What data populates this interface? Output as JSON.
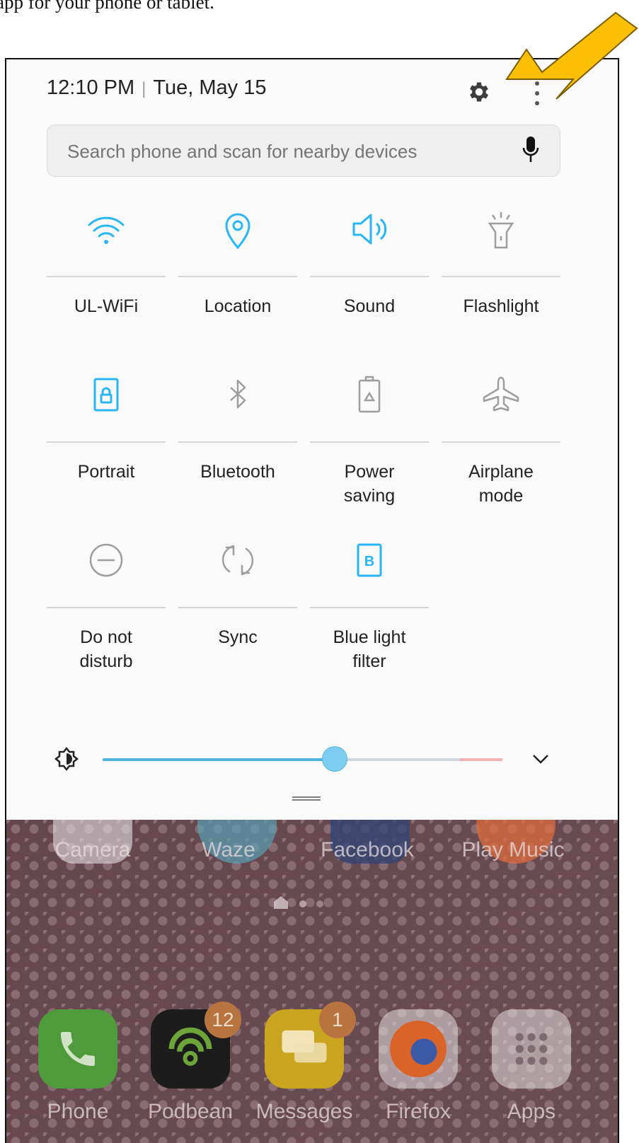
{
  "caption": {
    "text": "app for your phone or tablet."
  },
  "header": {
    "time": "12:10 PM",
    "separator": "|",
    "date": "Tue, May 15"
  },
  "search": {
    "placeholder": "Search phone and scan for nearby devices"
  },
  "colors": {
    "accent": "#29b6f6",
    "inactive": "#9e9e9e",
    "arrow": "#fbbf05"
  },
  "quick_tiles": [
    {
      "label": "UL-WiFi",
      "icon": "wifi-icon",
      "active": true
    },
    {
      "label": "Location",
      "icon": "location-pin-icon",
      "active": true
    },
    {
      "label": "Sound",
      "icon": "speaker-icon",
      "active": true
    },
    {
      "label": "Flashlight",
      "icon": "flashlight-icon",
      "active": false
    },
    {
      "label": "Portrait",
      "icon": "portrait-lock-icon",
      "active": true
    },
    {
      "label": "Bluetooth",
      "icon": "bluetooth-icon",
      "active": false
    },
    {
      "label": "Power\nsaving",
      "icon": "power-saving-icon",
      "active": false
    },
    {
      "label": "Airplane\nmode",
      "icon": "airplane-icon",
      "active": false
    },
    {
      "label": "Do not\ndisturb",
      "icon": "do-not-disturb-icon",
      "active": false
    },
    {
      "label": "Sync",
      "icon": "sync-icon",
      "active": false
    },
    {
      "label": "Blue light\nfilter",
      "icon": "blue-light-filter-icon",
      "active": true
    }
  ],
  "brightness": {
    "level": 0.58
  },
  "home": {
    "row1": [
      "Camera",
      "Waze",
      "Facebook",
      "Play Music"
    ],
    "dock": [
      {
        "label": "Phone",
        "icon": "phone-app-icon"
      },
      {
        "label": "Podbean",
        "icon": "podbean-app-icon",
        "badge": "12"
      },
      {
        "label": "Messages",
        "icon": "messages-app-icon",
        "badge": "1"
      },
      {
        "label": "Firefox",
        "icon": "firefox-app-icon"
      },
      {
        "label": "Apps",
        "icon": "apps-grid-icon"
      }
    ]
  }
}
